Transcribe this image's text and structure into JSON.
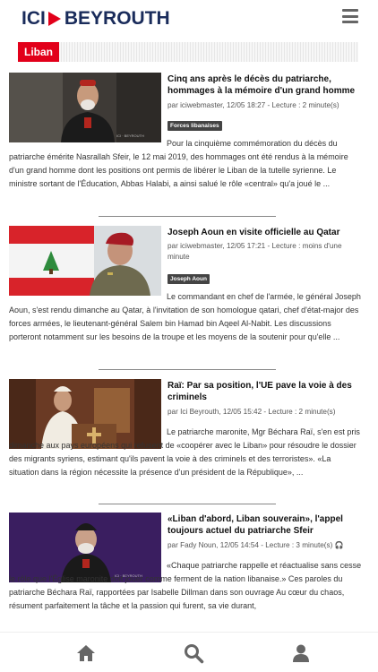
{
  "header": {
    "logo_ici": "ICI",
    "logo_city": "BEYROUTH",
    "menu_icon": "hamburger-menu-icon"
  },
  "section": {
    "label": "Liban"
  },
  "articles": [
    {
      "title": "Cinq ans après le décès du patriarche, hommages à la mémoire d'un grand homme",
      "meta": "par iciwebmaster, 12/05 18:27 - Lecture : 2 minute(s)",
      "badge": "Forces libanaises",
      "excerpt": "Pour la cinquième commémoration du décès du patriarche émérite Nasrallah Sfeir, le 12 mai 2019, des hommages ont été rendus à la mémoire d'un grand homme dont les positions ont permis de libérer le Liban de la tutelle syrienne. Le ministre sortant de l'Éducation, Abbas Halabi, a ainsi salué le rôle «central» qu'a joué le ...",
      "image": "cardinal-portrait",
      "colors": {
        "bg": "#3e3a36",
        "robe": "#1b1b1b",
        "skin": "#c79a7c",
        "accent": "#b3261e"
      }
    },
    {
      "title": "Joseph Aoun en visite officielle au Qatar",
      "meta": "par iciwebmaster, 12/05 17:21 - Lecture : moins d'une minute",
      "badge": "Joseph Aoun",
      "excerpt": "Le commandant en chef de l'armée, le général Joseph Aoun, s'est rendu dimanche au Qatar, à l'invitation de son homologue qatari, chef d'état-major des forces armées, le lieutenant-général Salem bin Hamad bin Aqeel Al-Nabit. Les discussions porteront notamment sur les besoins de la troupe et les moyens de la soutenir pour qu'elle ...",
      "image": "general-with-flag",
      "colors": {
        "bg": "#d9dde0",
        "flagRed": "#d8232a",
        "flagWhite": "#f4f4f4",
        "beret": "#a61b24",
        "uniform": "#6e6a4f"
      }
    },
    {
      "title": "Raï: Par sa position, l'UE pave la voie à des criminels",
      "meta": "par Ici Beyrouth, 12/05 15:42 - Lecture : 2 minute(s)",
      "badge": "",
      "excerpt": "Le patriarche maronite, Mgr Béchara Raï, s'en est pris dimanche aux pays européens qui refusent de «coopérer avec le Liban» pour résoudre le dossier des migrants syriens, estimant qu'ils pavent la voie à des criminels et des terroristes». «La situation dans la région nécessite la présence d'un président de la République», ...",
      "image": "patriarch-at-altar",
      "colors": {
        "bg": "#6a3a24",
        "altar": "#b07a45",
        "robe": "#f1ece2",
        "cross": "#d9b26b"
      }
    },
    {
      "title": "«Liban d'abord, Liban souverain», l'appel toujours actuel du patriarche Sfeir",
      "meta": "par Fady Noun, 12/05 14:54 - Lecture : 3 minute(s)",
      "badge": "",
      "excerpt": "«Chaque patriarche rappelle et réactualise sans cesse le rôle que l'Église maronite doit jouer comme ferment de la nation libanaise.» Ces paroles du patriarche Béchara Raï, rapportées par Isabelle Dillman dans son ouvrage Au cœur du chaos, résument parfaitement la tâche et la passion qui furent, sa vie durant,",
      "image": "patriarch-portrait-dark",
      "colors": {
        "bg": "#2a1a4a",
        "robe": "#1a1a1a",
        "skin": "#c9a089",
        "accent": "#6b2aa5"
      }
    }
  ],
  "bottom_nav": [
    {
      "name": "home-icon",
      "label": "home"
    },
    {
      "name": "search-icon",
      "label": "search"
    },
    {
      "name": "user-icon",
      "label": "account"
    }
  ],
  "colors": {
    "brand_red": "#e2001a",
    "brand_navy": "#1a2c5b",
    "icon_gray": "#666666"
  }
}
